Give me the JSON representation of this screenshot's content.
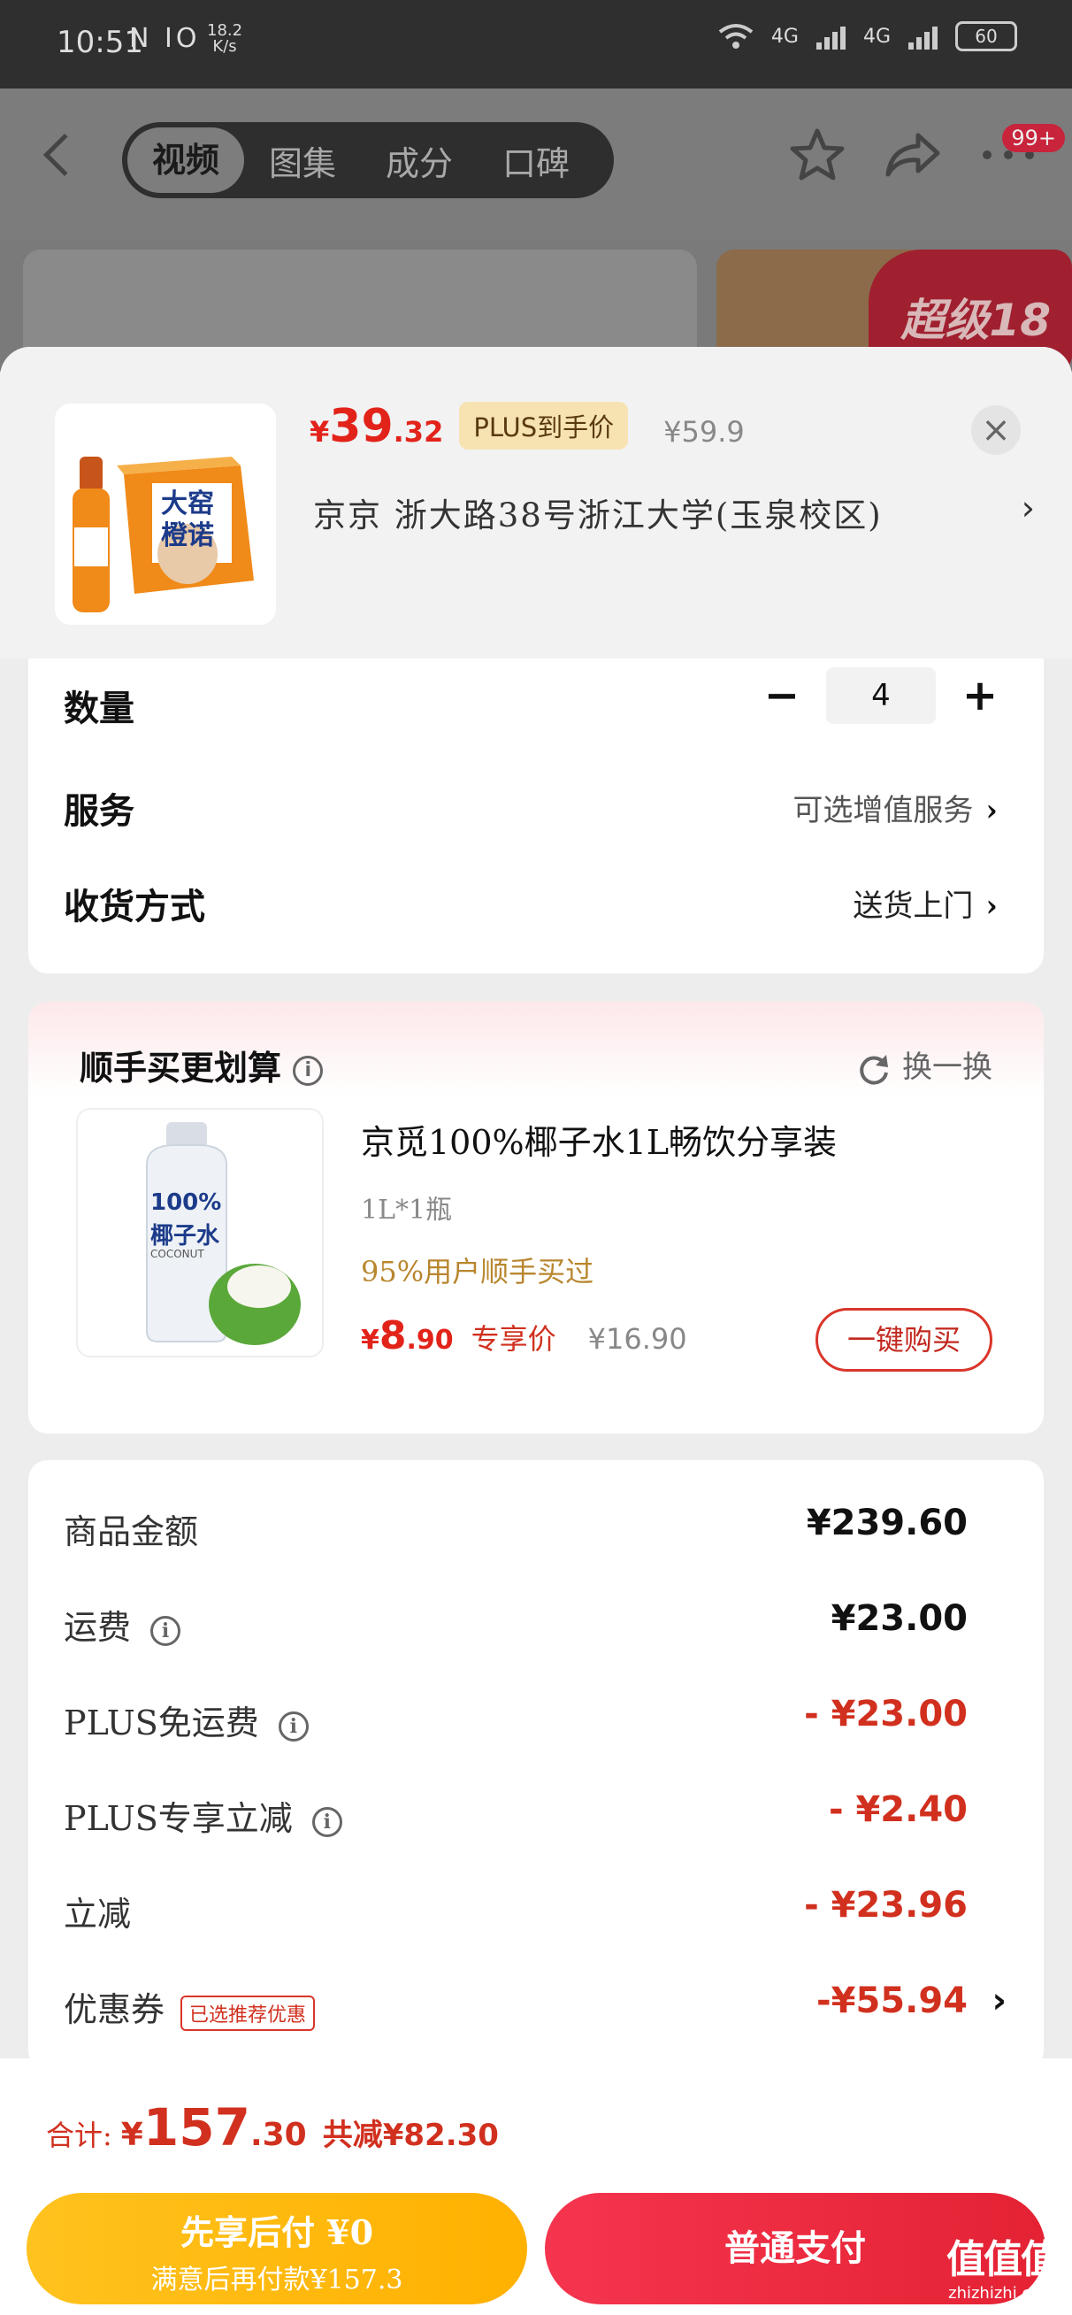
{
  "status_bar": {
    "time": "10:51",
    "left_icons": "N ⅠO",
    "speed_value": "18.2",
    "speed_unit": "K/s",
    "network_1": "4G",
    "network_2": "4G",
    "battery": "60"
  },
  "nav": {
    "tabs": [
      {
        "label": "视频",
        "active": true
      },
      {
        "label": "图集"
      },
      {
        "label": "成分"
      },
      {
        "label": "口碑"
      }
    ],
    "badge": "99+",
    "banner_text": "超级18"
  },
  "product": {
    "price_symbol": "¥",
    "price_int": "39",
    "price_dec": ".32",
    "plus_tag": "PLUS到手价",
    "original_price": "¥59.9",
    "close": "×",
    "address": "京京   浙大路38号浙江大学(玉泉校区)",
    "image_text_1": "大窑",
    "image_text_2": "橙诺"
  },
  "options": {
    "quantity": {
      "label": "数量",
      "value": "4",
      "minus": "−",
      "plus": "+"
    },
    "service": {
      "label": "服务",
      "value": "可选增值服务"
    },
    "delivery": {
      "label": "收货方式",
      "value": "送货上门"
    }
  },
  "recommend": {
    "title": "顺手买更划算",
    "swap_label": "换一换",
    "item": {
      "name": "京觅100%椰子水1L畅饮分享装",
      "spec": "1L*1瓶",
      "bought": "95%用户顺手买过",
      "price_symbol": "¥",
      "price_int": "8",
      "price_dec": ".90",
      "exclusive": "专享价",
      "original": "¥16.90",
      "buy_label": "一键购买",
      "image_text_1": "100%",
      "image_text_2": "椰子水",
      "image_text_3": "COCONUT"
    }
  },
  "fees": [
    {
      "label": "商品金额",
      "amount": "¥239.60",
      "info": false,
      "red": false
    },
    {
      "label": "运费",
      "amount": "¥23.00",
      "info": true,
      "red": false
    },
    {
      "label": "PLUS免运费",
      "amount": "- ¥23.00",
      "info": true,
      "red": true
    },
    {
      "label": "PLUS专享立减",
      "amount": "- ¥2.40",
      "info": true,
      "red": true
    },
    {
      "label": "立减",
      "amount": "- ¥23.96",
      "info": false,
      "red": true
    },
    {
      "label": "优惠券",
      "amount": "-¥55.94",
      "info": false,
      "red": true,
      "tag": "已选推荐优惠"
    }
  ],
  "bottom": {
    "total_label": "合计:",
    "total_symbol": "¥",
    "total_int": "157",
    "total_dec": ".30",
    "saving": "共减¥82.30",
    "pay_later_line1": "先享后付 ¥0",
    "pay_later_line2": "满意后再付款¥157.3",
    "pay_normal": "普通支付",
    "watermark": "值值值",
    "watermark_url": "zhizhizhi.com"
  },
  "colors": {
    "accent_red": "#e2231a",
    "pay_yellow": "#ffb100",
    "pay_red": "#e42234",
    "gold_text": "#b8862e"
  }
}
